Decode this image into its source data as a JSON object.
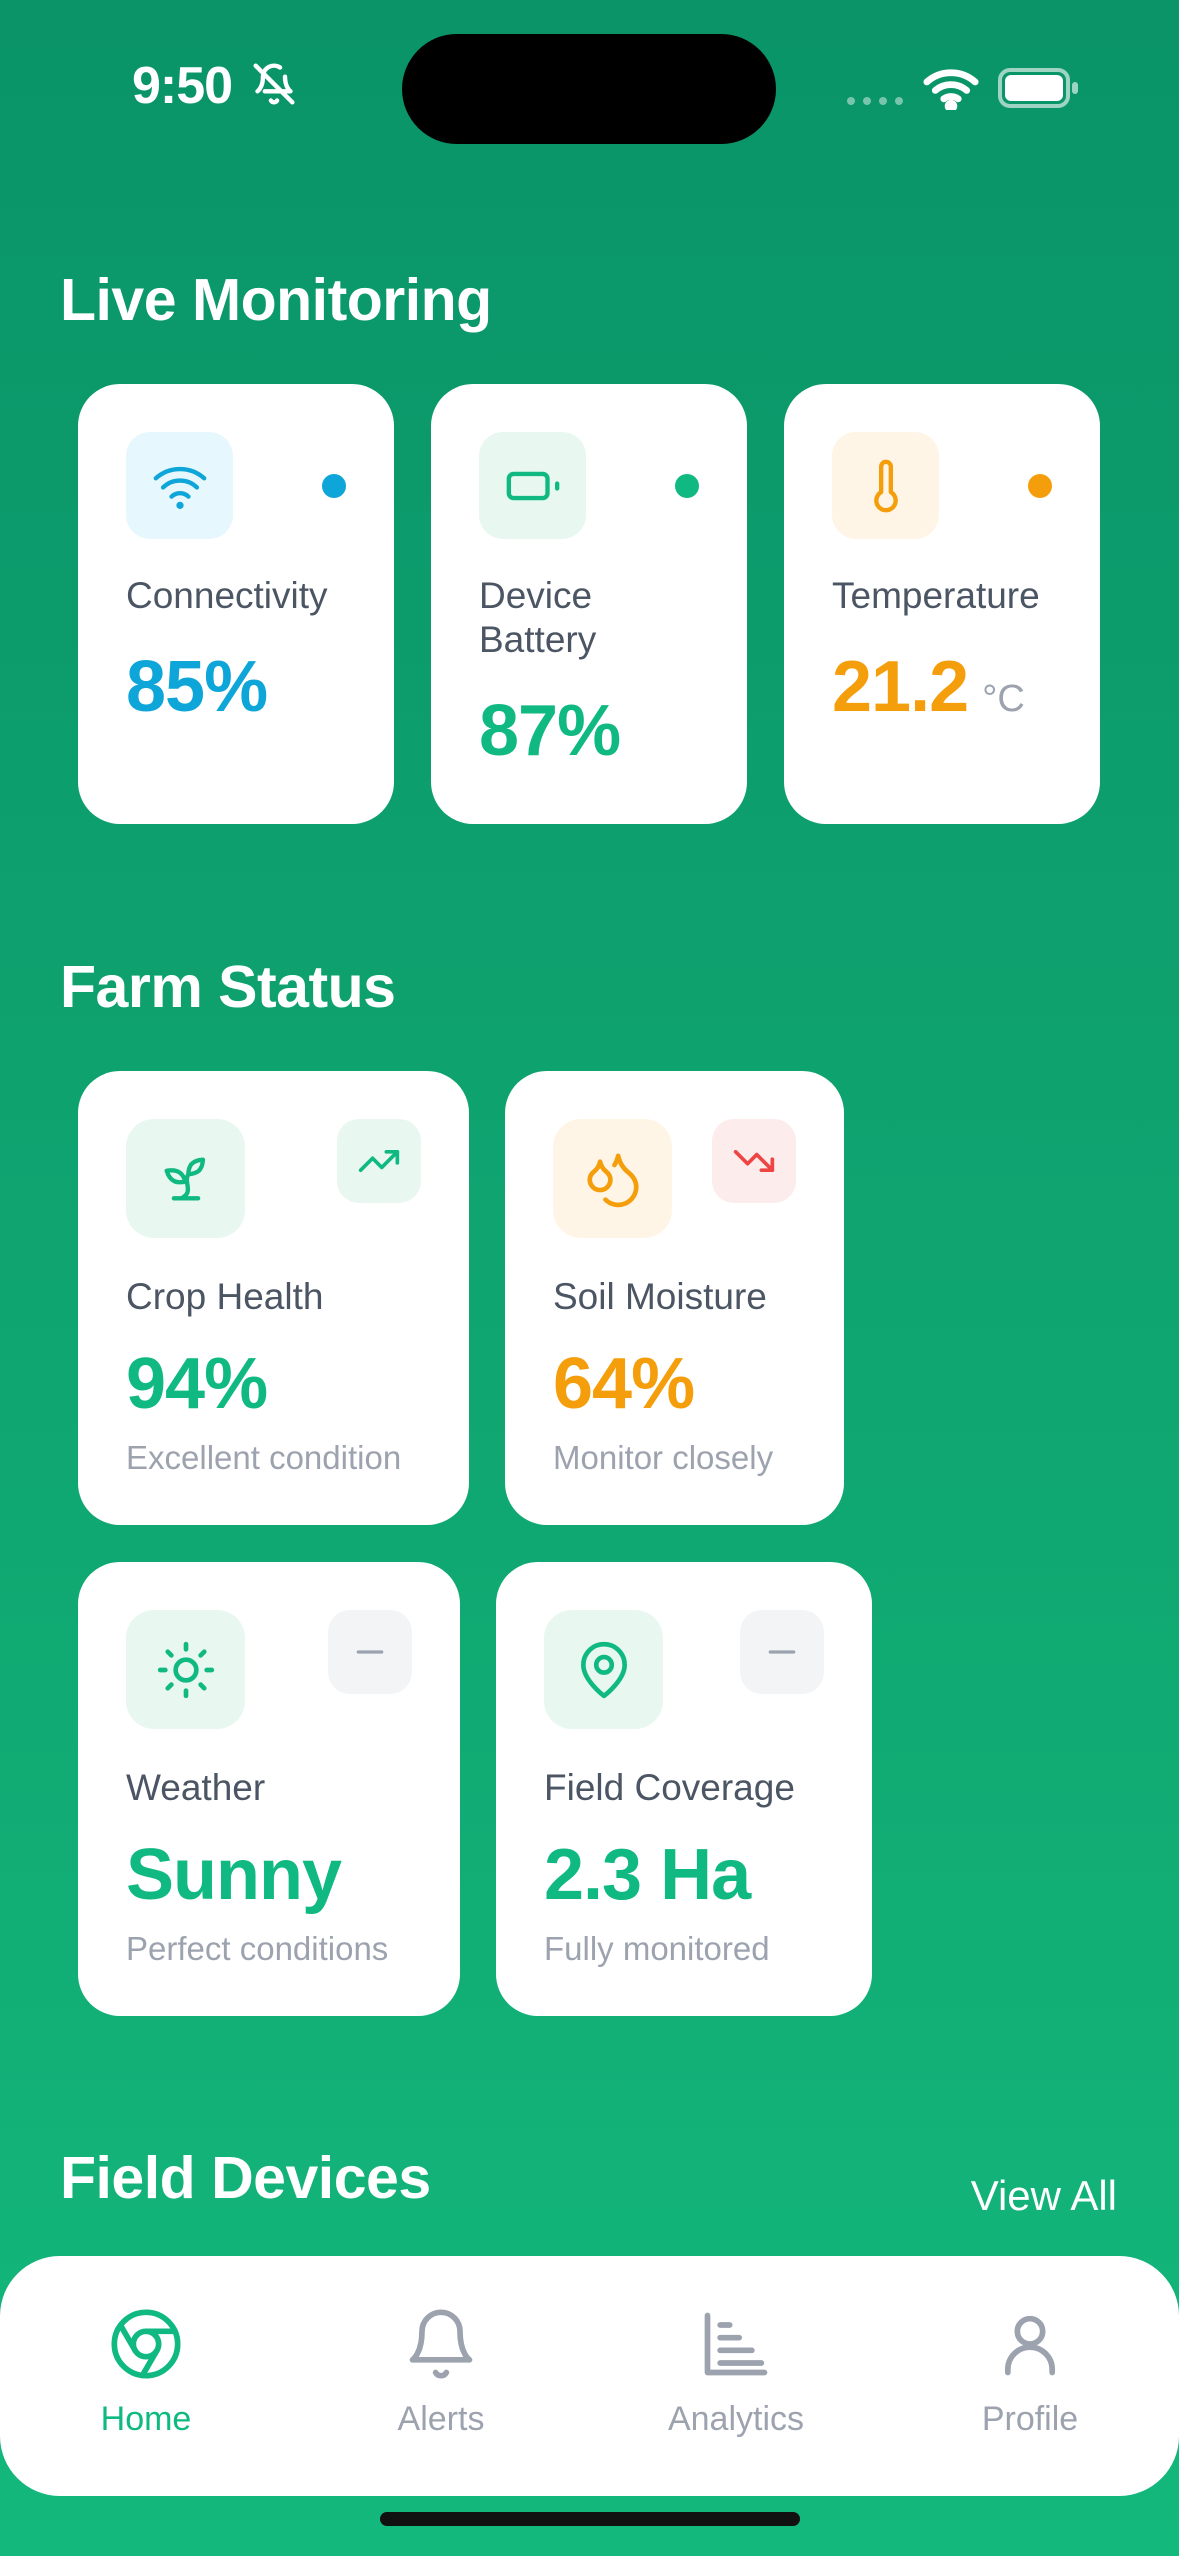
{
  "status_bar": {
    "time": "9:50"
  },
  "sections": {
    "live_monitoring": "Live Monitoring",
    "farm_status": "Farm Status",
    "field_devices": "Field Devices",
    "view_all": "View All"
  },
  "live": [
    {
      "label": "Connectivity",
      "value": "85%",
      "color": "#0ea5d8",
      "icon": "wifi-icon"
    },
    {
      "label": "Device Battery",
      "value": "87%",
      "color": "#10b981",
      "icon": "battery-icon"
    },
    {
      "label": "Temperature",
      "value": "21.2",
      "unit": "°C",
      "color": "#f59e0b",
      "icon": "thermometer-icon"
    }
  ],
  "farm": [
    {
      "label": "Crop Health",
      "value": "94%",
      "sub": "Excellent condition",
      "color": "#10b981",
      "icon": "sprout-icon",
      "trend": "trending-up-icon"
    },
    {
      "label": "Soil Moisture",
      "value": "64%",
      "sub": "Monitor closely",
      "color": "#f59e0b",
      "icon": "droplets-icon",
      "trend": "trending-down-icon"
    },
    {
      "label": "Weather",
      "value": "Sunny",
      "sub": "Perfect conditions",
      "color": "#10b981",
      "icon": "sun-icon",
      "trend": "minus-icon"
    },
    {
      "label": "Field Coverage",
      "value": "2.3 Ha",
      "sub": "Fully monitored",
      "color": "#10b981",
      "icon": "map-pin-icon",
      "trend": "minus-icon"
    }
  ],
  "nav": [
    {
      "label": "Home",
      "icon": "chrome-icon",
      "active": true
    },
    {
      "label": "Alerts",
      "icon": "bell-icon",
      "active": false
    },
    {
      "label": "Analytics",
      "icon": "bar-chart-icon",
      "active": false
    },
    {
      "label": "Profile",
      "icon": "user-icon",
      "active": false
    }
  ]
}
